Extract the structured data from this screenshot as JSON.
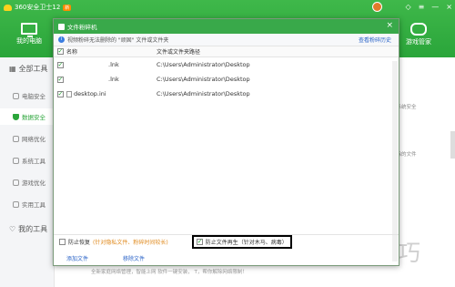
{
  "app": {
    "title": "360安全卫士12",
    "badge": "新",
    "nav_my_pc": "我的电脑",
    "nav_game": "游戏管家"
  },
  "sidebar": {
    "all_tools": "全部工具",
    "items": [
      {
        "label": "电脑安全",
        "active": false
      },
      {
        "label": "数据安全",
        "active": true
      },
      {
        "label": "网络优化",
        "active": false
      },
      {
        "label": "系统工具",
        "active": false
      },
      {
        "label": "游戏优化",
        "active": false
      },
      {
        "label": "实用工具",
        "active": false
      }
    ],
    "my_tools": "我的工具"
  },
  "base": {
    "right_text_1": "护系统安全",
    "right_text_2": "删除的文件",
    "bottom_text": "全新家庭网络管理，智能上网   软件一键安装，   T，帮你解除网络限制！"
  },
  "dialog": {
    "title": "文件粉碎机",
    "close": "×",
    "info": "视频粉碎无法删除的 \"顽固\" 文件或文件夹",
    "history_link": "查看粉碎历史",
    "col_name": "名称",
    "col_path": "文件或文件夹路径",
    "rows": [
      {
        "name": ".lnk",
        "path": "C:\\Users\\Administrator\\Desktop",
        "checked": true,
        "blurred": true
      },
      {
        "name": ".lnk",
        "path": "C:\\Users\\Administrator\\Desktop",
        "checked": true,
        "blurred": true
      },
      {
        "name": "desktop.ini",
        "path": "C:\\Users\\Administrator\\Desktop",
        "checked": true,
        "blurred": false
      }
    ],
    "opt_restore": "防止恢复",
    "opt_restore_note": "(针对隐私文件、粉碎时间较长)",
    "opt_regen": "防止文件再生（针对木马、病毒）",
    "add_file": "添加文件",
    "remove_file": "移除文件"
  },
  "watermark": "软件技巧"
}
